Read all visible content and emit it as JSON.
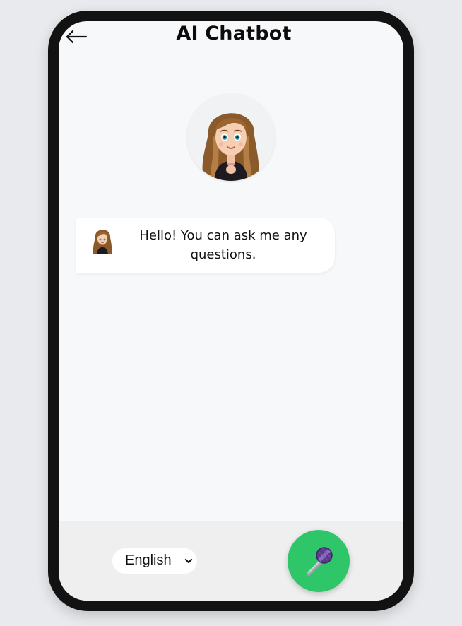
{
  "header": {
    "title": "AI Chatbot",
    "back_icon": "arrow-left-icon"
  },
  "assistant": {
    "avatar_icon": "girl-avatar-icon"
  },
  "messages": [
    {
      "sender": "bot",
      "avatar_icon": "girl-avatar-icon",
      "text": "Hello! You can ask me any questions."
    }
  ],
  "footer": {
    "language_select": {
      "selected": "English",
      "icon": "chevron-down-icon"
    },
    "mic_button": {
      "icon": "microphone-icon"
    }
  },
  "colors": {
    "phone_frame": "#121212",
    "screen_bg": "#f7f8fa",
    "bottom_bar_bg": "#efefef",
    "mic_button_bg": "#2fc66a"
  }
}
